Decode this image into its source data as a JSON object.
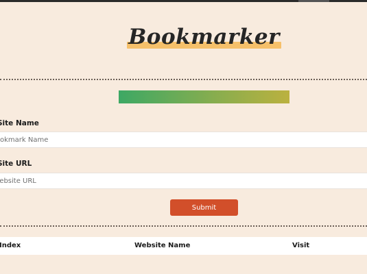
{
  "app": {
    "title": "Bookmarker"
  },
  "form": {
    "name_label": "Site Name",
    "name_placeholder": "Bookmark Name",
    "url_label": "Site URL",
    "url_placeholder": "Website URL",
    "submit_label": "Submit"
  },
  "table": {
    "headers": [
      "Index",
      "Website Name",
      "Visit"
    ]
  },
  "colors": {
    "background": "#f8ebde",
    "logo_highlight": "#f6c06a",
    "gradient_start": "#3da864",
    "gradient_end": "#bbb13f",
    "submit_button": "#d24f2a"
  }
}
